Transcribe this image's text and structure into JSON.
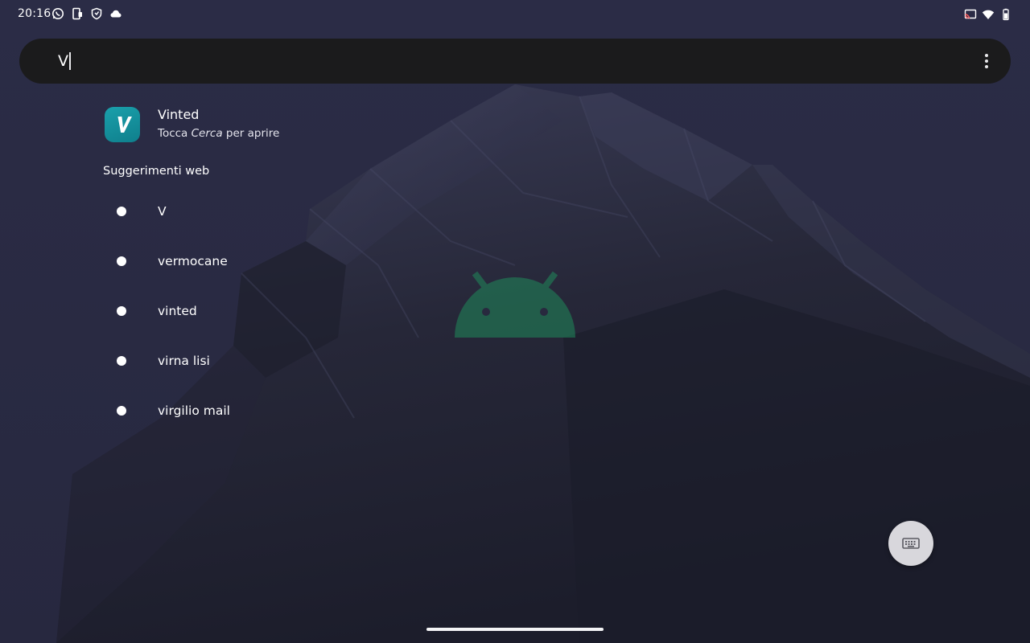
{
  "status_bar": {
    "time": "20:16",
    "left_icons": [
      "whatsapp-icon",
      "phone-tablet-icon",
      "shield-icon",
      "cloud-icon"
    ],
    "right_icons": [
      "cast-icon",
      "wifi-icon",
      "battery-icon"
    ]
  },
  "search": {
    "query": "V",
    "more_options_icon": "more-vert-icon"
  },
  "app_result": {
    "name": "Vinted",
    "icon_letter": "V",
    "icon_color": "#1596a2",
    "hint_prefix": "Tocca ",
    "hint_emphasis": "Cerca",
    "hint_suffix": " per aprire"
  },
  "web_suggestions": {
    "heading": "Suggerimenti web",
    "items": [
      {
        "label": "V"
      },
      {
        "label": "vermocane"
      },
      {
        "label": "vinted"
      },
      {
        "label": "virna lisi"
      },
      {
        "label": "virgilio mail"
      }
    ]
  },
  "keyboard_button": {
    "icon": "keyboard-icon"
  },
  "colors": {
    "background": "#2a2b44",
    "search_bar": "#1b1b1c",
    "fab": "#d8d7dc",
    "watermark_green": "#1f8a5a"
  }
}
